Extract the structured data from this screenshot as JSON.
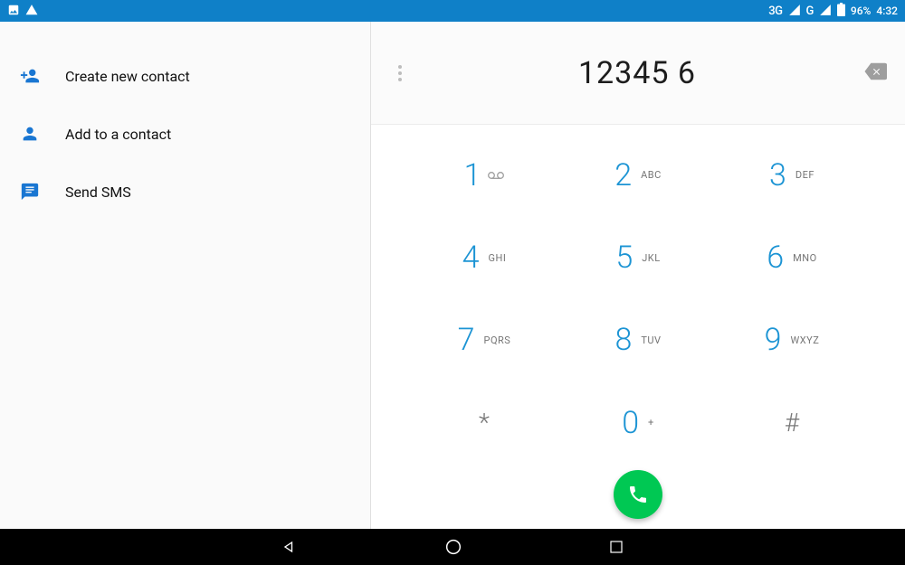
{
  "status": {
    "net1": "3G",
    "net2": "G",
    "battery": "96%",
    "time": "4:32"
  },
  "actions": {
    "create": "Create new contact",
    "add": "Add to a contact",
    "sms": "Send SMS"
  },
  "dialer": {
    "number": "12345 6",
    "keys": {
      "k1": {
        "n": "1",
        "l": ""
      },
      "k2": {
        "n": "2",
        "l": "ABC"
      },
      "k3": {
        "n": "3",
        "l": "DEF"
      },
      "k4": {
        "n": "4",
        "l": "GHI"
      },
      "k5": {
        "n": "5",
        "l": "JKL"
      },
      "k6": {
        "n": "6",
        "l": "MNO"
      },
      "k7": {
        "n": "7",
        "l": "PQRS"
      },
      "k8": {
        "n": "8",
        "l": "TUV"
      },
      "k9": {
        "n": "9",
        "l": "WXYZ"
      },
      "kstar": {
        "n": "*",
        "l": ""
      },
      "k0": {
        "n": "0",
        "l": "+"
      },
      "khash": {
        "n": "#",
        "l": ""
      }
    }
  }
}
